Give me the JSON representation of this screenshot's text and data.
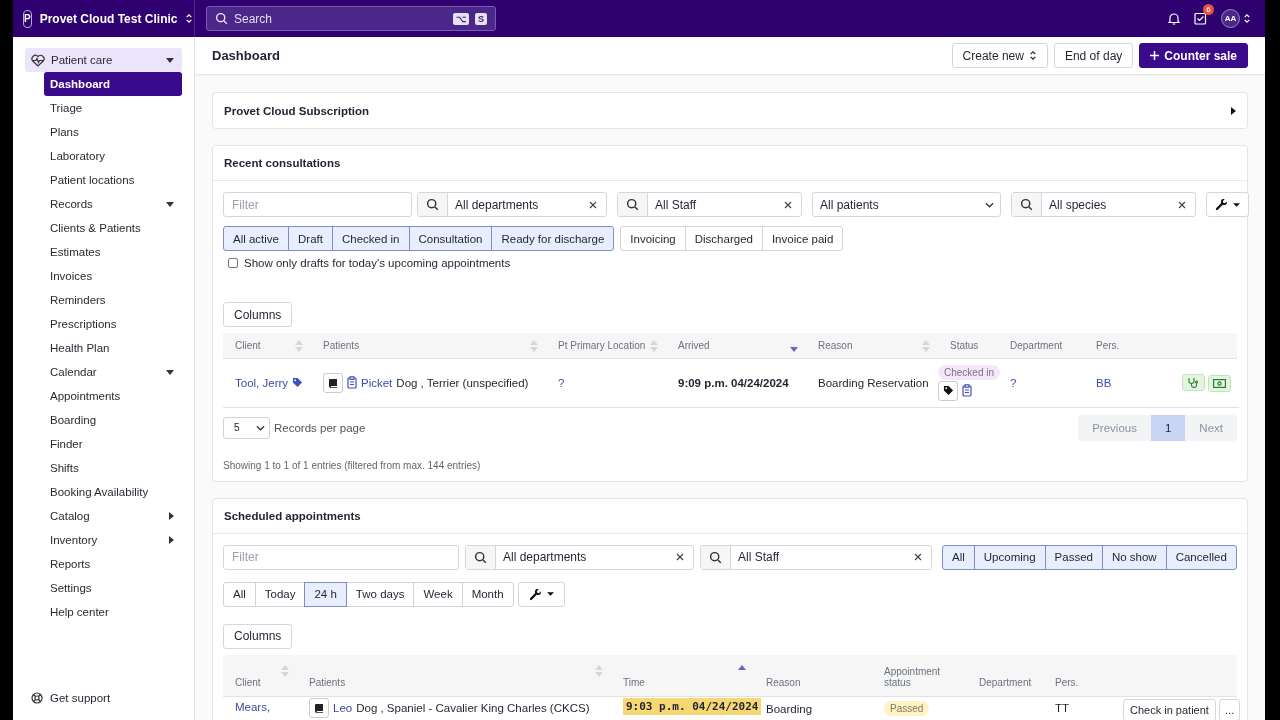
{
  "topbar": {
    "clinic_initial": "P",
    "clinic_name": "Provet Cloud Test Clinic",
    "search_placeholder": "Search",
    "shortcut_keys": [
      "⌥",
      "S"
    ],
    "tasks_badge": "6",
    "user_initials": "AA"
  },
  "sidebar": {
    "items": [
      {
        "label": "Patient care",
        "kind": "group",
        "expanded": true,
        "selected": true,
        "children": [
          {
            "label": "Dashboard",
            "selected": true
          },
          {
            "label": "Triage",
            "selected": false
          },
          {
            "label": "Plans",
            "selected": false
          },
          {
            "label": "Laboratory",
            "selected": false
          },
          {
            "label": "Patient locations",
            "selected": false
          }
        ]
      },
      {
        "label": "Records",
        "kind": "group",
        "expanded": true,
        "selected": false,
        "children": [
          {
            "label": "Clients & Patients",
            "selected": false
          },
          {
            "label": "Estimates",
            "selected": false
          },
          {
            "label": "Invoices",
            "selected": false
          },
          {
            "label": "Reminders",
            "selected": false
          },
          {
            "label": "Prescriptions",
            "selected": false
          },
          {
            "label": "Health Plan",
            "selected": false
          }
        ]
      },
      {
        "label": "Calendar",
        "kind": "group",
        "expanded": true,
        "selected": false,
        "children": [
          {
            "label": "Appointments",
            "selected": false
          },
          {
            "label": "Boarding",
            "selected": false
          },
          {
            "label": "Finder",
            "selected": false
          },
          {
            "label": "Shifts",
            "selected": false
          },
          {
            "label": "Booking Availability",
            "selected": false
          }
        ]
      },
      {
        "label": "Catalog",
        "kind": "group",
        "expanded": false,
        "selected": false
      },
      {
        "label": "Inventory",
        "kind": "group",
        "expanded": false,
        "selected": false
      },
      {
        "label": "Reports",
        "kind": "link",
        "selected": false
      },
      {
        "label": "Settings",
        "kind": "link",
        "selected": false
      },
      {
        "label": "Help center",
        "kind": "link",
        "selected": false
      }
    ],
    "support_label": "Get support"
  },
  "page": {
    "title": "Dashboard",
    "actions": [
      {
        "label": "Create new",
        "kind": "dropdown"
      },
      {
        "label": "End of day",
        "kind": "plain"
      },
      {
        "label": "Counter sale",
        "kind": "primary"
      }
    ]
  },
  "subscription": {
    "title": "Provet Cloud Subscription",
    "expanded": false
  },
  "recent_consultations": {
    "title": "Recent consultations",
    "filter_placeholder": "Filter",
    "filters": [
      {
        "kind": "search",
        "value": "All departments"
      },
      {
        "kind": "search",
        "value": "All Staff"
      },
      {
        "kind": "select",
        "value": "All patients"
      },
      {
        "kind": "search",
        "value": "All species"
      }
    ],
    "status_buttons": [
      {
        "label": "All active",
        "selected": true
      },
      {
        "label": "Draft",
        "selected": true
      },
      {
        "label": "Checked in",
        "selected": true
      },
      {
        "label": "Consultation",
        "selected": true
      },
      {
        "label": "Ready for discharge",
        "selected": true
      },
      {
        "label": "Invoicing",
        "selected": false
      },
      {
        "label": "Discharged",
        "selected": false
      },
      {
        "label": "Invoice paid",
        "selected": false
      }
    ],
    "drafts_checkbox": {
      "label": "Show only drafts for today's upcoming appointments",
      "checked": false
    },
    "columns_button": "Columns",
    "table": {
      "columns": [
        {
          "label": "Client",
          "sortable": true,
          "sorted": false
        },
        {
          "label": "Patients",
          "sortable": true,
          "sorted": false
        },
        {
          "label": "Pt Primary Location",
          "sortable": true,
          "sorted": false
        },
        {
          "label": "Arrived",
          "sortable": true,
          "sorted": true,
          "descending": true
        },
        {
          "label": "Reason",
          "sortable": true,
          "sorted": false
        },
        {
          "label": "Status",
          "sortable": false
        },
        {
          "label": "Department",
          "sortable": false
        },
        {
          "label": "Pers.",
          "sortable": false
        }
      ],
      "rows": [
        {
          "client": "Tool, Jerry",
          "patient": "Picket",
          "patient_detail": "Dog , Terrier (unspecified)",
          "location": "?",
          "arrived": "9:09 p.m. 04/24/2024",
          "reason": "Boarding Reservation",
          "status": {
            "label": "Checked in",
            "color": "#f5e6fb"
          },
          "department": "?",
          "staff": "BB"
        }
      ]
    },
    "per_page": "5",
    "per_page_label": "Records per page",
    "pages": [
      {
        "label": "Previous",
        "kind": "nav",
        "disabled": true
      },
      {
        "label": "1",
        "kind": "page",
        "selected": true
      },
      {
        "label": "Next",
        "kind": "nav",
        "disabled": true
      }
    ],
    "info": "Showing 1 to 1 of 1 entries (filtered from max. 144 entries)"
  },
  "scheduled_appointments": {
    "title": "Scheduled appointments",
    "filter_placeholder": "Filter",
    "filters": [
      {
        "kind": "search",
        "value": "All departments"
      },
      {
        "kind": "search",
        "value": "All Staff"
      }
    ],
    "status_buttons": [
      {
        "label": "All",
        "selected": true
      },
      {
        "label": "Upcoming",
        "selected": true
      },
      {
        "label": "Passed",
        "selected": true
      },
      {
        "label": "No show",
        "selected": true
      },
      {
        "label": "Cancelled",
        "selected": true
      }
    ],
    "range_buttons": [
      {
        "label": "All",
        "selected": false
      },
      {
        "label": "Today",
        "selected": false
      },
      {
        "label": "24 h",
        "selected": true
      },
      {
        "label": "Two days",
        "selected": false
      },
      {
        "label": "Week",
        "selected": false
      },
      {
        "label": "Month",
        "selected": false
      }
    ],
    "columns_button": "Columns",
    "table": {
      "columns": [
        {
          "label": "Client",
          "sortable": true,
          "sorted": false
        },
        {
          "label": "Patients",
          "sortable": true,
          "sorted": false
        },
        {
          "label": "Time",
          "sortable": true,
          "sorted": true,
          "descending": false
        },
        {
          "label": "Reason",
          "sortable": false
        },
        {
          "label": "Appointment status",
          "sortable": false
        },
        {
          "label": "Department",
          "sortable": false
        },
        {
          "label": "Pers.",
          "sortable": false
        }
      ],
      "rows": [
        {
          "client": "Mears,",
          "patient": "Leo",
          "patient_detail": "Dog , Spaniel - Cavalier King Charles (CKCS)",
          "time": "9:03 p.m. 04/24/2024",
          "time_highlighted": true,
          "reason": "Boarding",
          "status": {
            "label": "Passed",
            "color": "#fff3c4"
          },
          "staff": "TT",
          "action": "Check in patient",
          "more": "..."
        }
      ]
    }
  }
}
